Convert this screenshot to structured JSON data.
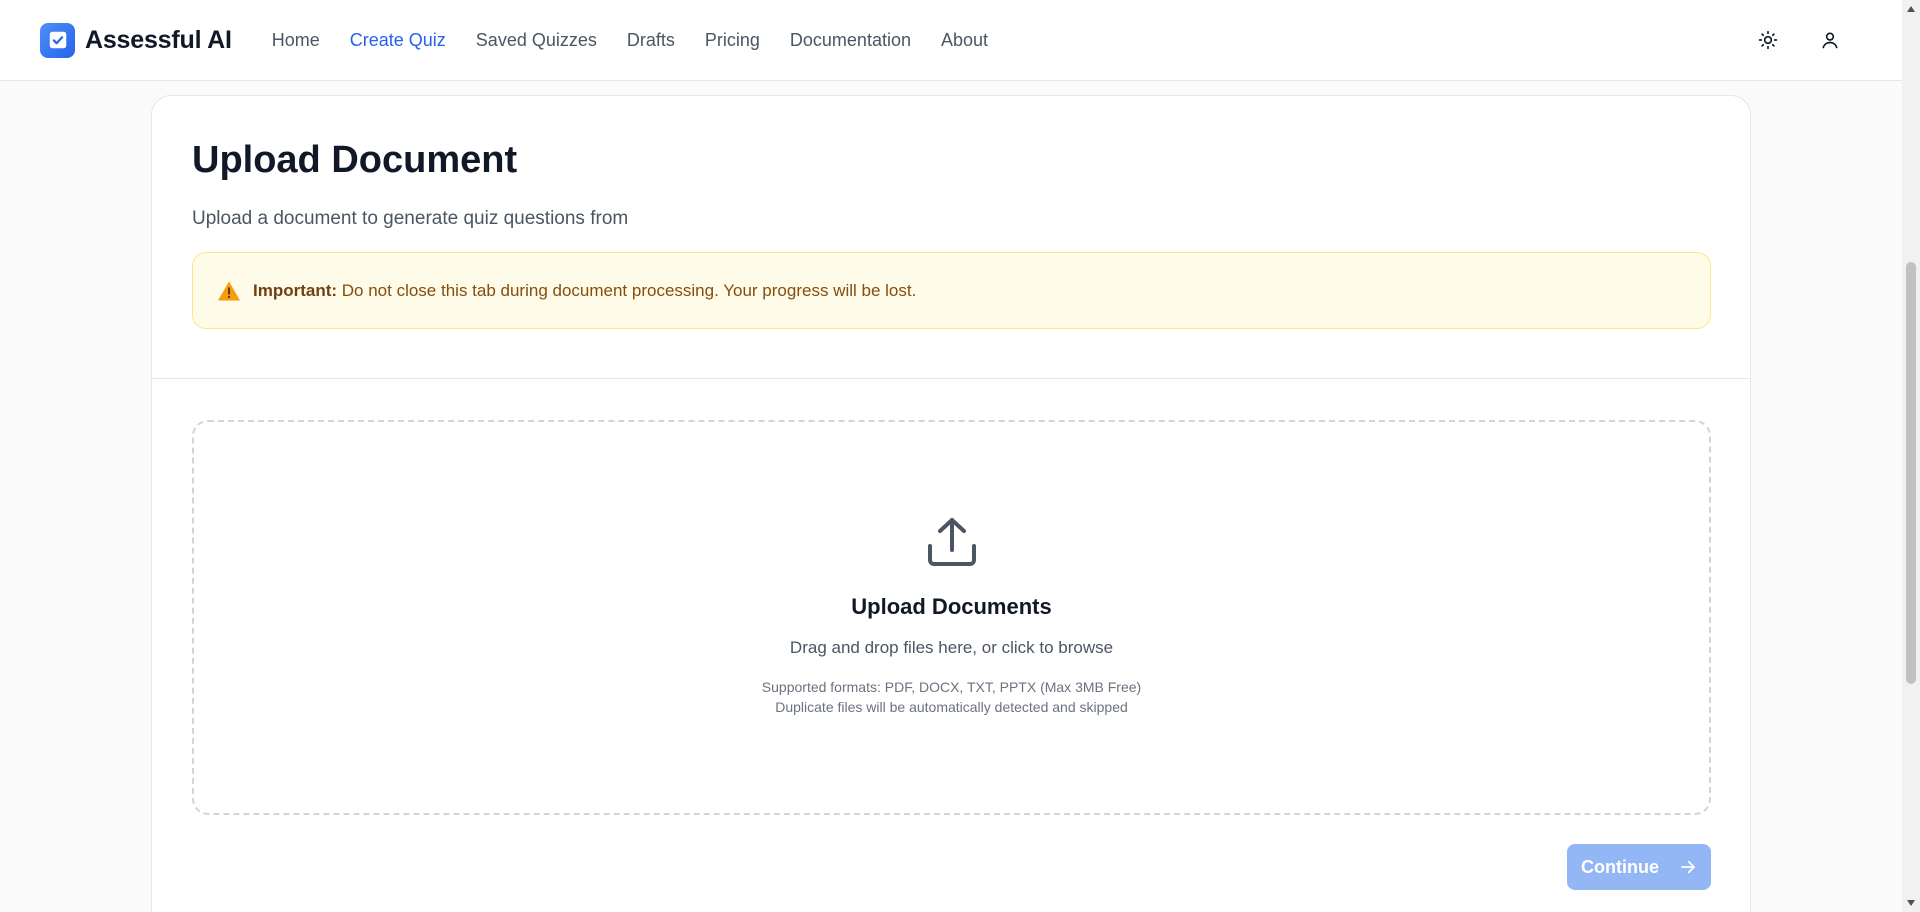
{
  "brand": {
    "name": "Assessful AI",
    "logo_icon": "check-square-icon",
    "accent": "#2563eb"
  },
  "nav": {
    "items": [
      {
        "label": "Home",
        "active": false
      },
      {
        "label": "Create Quiz",
        "active": true
      },
      {
        "label": "Saved Quizzes",
        "active": false
      },
      {
        "label": "Drafts",
        "active": false
      },
      {
        "label": "Pricing",
        "active": false
      },
      {
        "label": "Documentation",
        "active": false
      },
      {
        "label": "About",
        "active": false
      }
    ]
  },
  "header_actions": {
    "theme_icon": "sun-icon",
    "user_icon": "user-icon"
  },
  "main": {
    "title": "Upload Document",
    "subtitle": "Upload a document to generate quiz questions from",
    "alert": {
      "icon": "warning-icon",
      "strong": "Important:",
      "text": " Do not close this tab during document processing. Your progress will be lost.",
      "colors": {
        "bg": "#fefce8",
        "border": "#fde68a",
        "text": "#854d0e",
        "icon": "#f59e0b"
      }
    },
    "dropzone": {
      "icon": "upload-icon",
      "title": "Upload Documents",
      "description": "Drag and drop files here, or click to browse",
      "formats": "Supported formats: PDF, DOCX, TXT, PPTX (Max 3MB Free)",
      "duplicates": "Duplicate files will be automatically detected and skipped"
    },
    "continue": {
      "label": "Continue",
      "icon": "arrow-right-icon",
      "color": "#93b6f5"
    }
  }
}
